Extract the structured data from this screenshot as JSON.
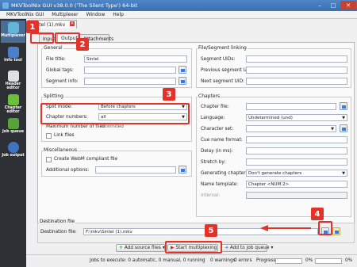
{
  "window": {
    "title": "MKVToolNix GUI v38.0.0 ('The Silent Type') 64-bit",
    "controls": {
      "minimize": "–",
      "maximize": "□",
      "close": "✕"
    }
  },
  "menu": {
    "items": [
      "MKVToolNix GUI",
      "Multiplexer",
      "Window",
      "Help"
    ]
  },
  "sidebar": {
    "items": [
      {
        "label": "Multiplexer",
        "icon": "multiplexer-icon"
      },
      {
        "label": "Info tool",
        "icon": "info-tool-icon"
      },
      {
        "label": "Header editor",
        "icon": "header-editor-icon"
      },
      {
        "label": "Chapter editor",
        "icon": "chapter-editor-icon"
      },
      {
        "label": "Job queue",
        "icon": "job-queue-icon"
      },
      {
        "label": "Job output",
        "icon": "job-output-icon"
      }
    ]
  },
  "file_tab": {
    "label": "Sintel (1).mkv"
  },
  "subtabs": {
    "input": "Input",
    "output": "Output",
    "attachments": "Attachments"
  },
  "general": {
    "title": "General",
    "file_title_label": "File title:",
    "file_title_value": "Sintel",
    "global_tags_label": "Global tags:",
    "segment_info_label": "Segment info:"
  },
  "splitting": {
    "title": "Splitting",
    "split_mode_label": "Split mode:",
    "split_mode_value": "Before chapters",
    "chapter_numbers_label": "Chapter numbers:",
    "chapter_numbers_value": "all",
    "max_files_label": "Maximum number of files:",
    "max_files_value": "Unlimited",
    "link_files_label": "Link files"
  },
  "misc": {
    "title": "Miscellaneous",
    "webm_label": "Create WebM compliant file",
    "additional_options_label": "Additional options:"
  },
  "linking": {
    "title": "File/Segment linking",
    "segment_uids_label": "Segment UIDs:",
    "prev_uid_label": "Previous segment UID:",
    "next_uid_label": "Next segment UID:"
  },
  "chapters": {
    "title": "Chapters",
    "chapter_file_label": "Chapter file:",
    "language_label": "Language:",
    "language_value": "Undetermined (und)",
    "charset_label": "Character set:",
    "cue_label": "Cue name format:",
    "delay_label": "Delay (in ms):",
    "stretch_label": "Stretch by:",
    "generating_label": "Generating chapters:",
    "generating_value": "Don't generate chapters",
    "name_template_label": "Name template:",
    "name_template_value": "Chapter <NUM:2>",
    "interval_label": "Interval:"
  },
  "destination": {
    "title": "Destination file",
    "label": "Destination file:",
    "value": "F:\\mkv\\Sintel (1).mkv"
  },
  "actions": {
    "add_source": "Add source files",
    "start": "Start multiplexing",
    "add_queue": "Add to job queue"
  },
  "status": {
    "jobs": "Jobs to execute: 0 automatic, 0 manual, 0 running",
    "warnings": "0 warnings",
    "errors": "0 errors",
    "progress_label": "Progress:",
    "progress1": "0%",
    "progress2": "0%"
  },
  "annotations": {
    "b1": "1",
    "b2": "2",
    "b3": "3",
    "b4": "4",
    "b5": "5"
  },
  "colors": {
    "annotation": "#e2332b",
    "sidebar": "#2d3035",
    "titlebar": "#3b6fb0"
  }
}
